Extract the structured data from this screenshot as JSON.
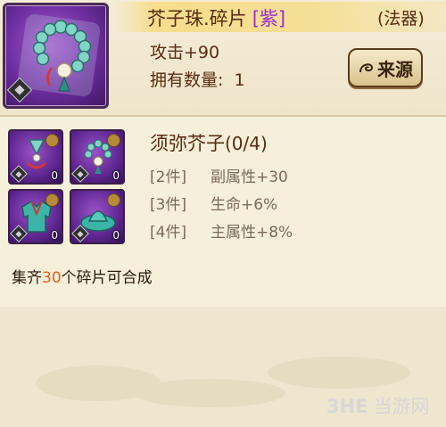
{
  "item": {
    "name": "芥子珠.碎片",
    "quality": "[紫]",
    "type": "(法器)",
    "stat": "攻击+90",
    "count_label": "拥有数量:",
    "count_value": "1",
    "source_button": "来源",
    "icon": "prayer-beads-icon"
  },
  "set": {
    "name": "须弥芥子",
    "progress": "(0/4)",
    "pieces": [
      {
        "icon": "bag-pendant-icon",
        "qty": "0"
      },
      {
        "icon": "prayer-beads-icon",
        "qty": "0"
      },
      {
        "icon": "robe-icon",
        "qty": "0"
      },
      {
        "icon": "hat-icon",
        "qty": "0"
      }
    ],
    "bonuses": [
      {
        "pieces": "[2件]",
        "effect": "副属性+30"
      },
      {
        "pieces": "[3件]",
        "effect": "生命+6%"
      },
      {
        "pieces": "[4件]",
        "effect": "主属性+8%"
      }
    ]
  },
  "collect": {
    "prefix": "集齐",
    "number": "30",
    "suffix": "个碎片可合成"
  },
  "watermark": {
    "logo": "3HE",
    "text": "当游网"
  },
  "colors": {
    "quality_purple": "#9a2fd0",
    "highlight_orange": "#e2611a",
    "text_brown": "#5a2b12"
  }
}
